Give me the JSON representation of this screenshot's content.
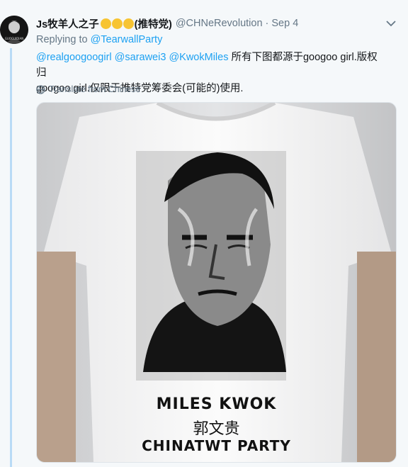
{
  "tweet": {
    "author_name": "Js牧羊人之子",
    "author_suffix": "(推特党)",
    "handle": "@CHNeRevolution",
    "separator": "·",
    "date": "Sep 4",
    "replying_prefix": "Replying to",
    "replying_to": "@TearwallParty",
    "mentions": [
      "@realgoogoogirl",
      "@sarawei3",
      "@KwokMiles"
    ],
    "text_line1_tail": "所有下图都源于googoo girl.版权归",
    "text_line2": "googoo girl.仅限于推特党筹委会(可能的)使用.",
    "translate_label": "Translate from Chinese",
    "emoji": [
      "raised-fist",
      "raised-fist",
      "raised-fist"
    ],
    "avatar_text": "GUOGUIDIAN"
  },
  "media": {
    "line1": "MILES KWOK",
    "line2": "郭文贵",
    "line3": "CHINATWT PARTY"
  },
  "colors": {
    "link": "#1da1f2",
    "secondary": "#657786",
    "thread_line": "#b9dbf6",
    "emoji": "#f7c432"
  }
}
